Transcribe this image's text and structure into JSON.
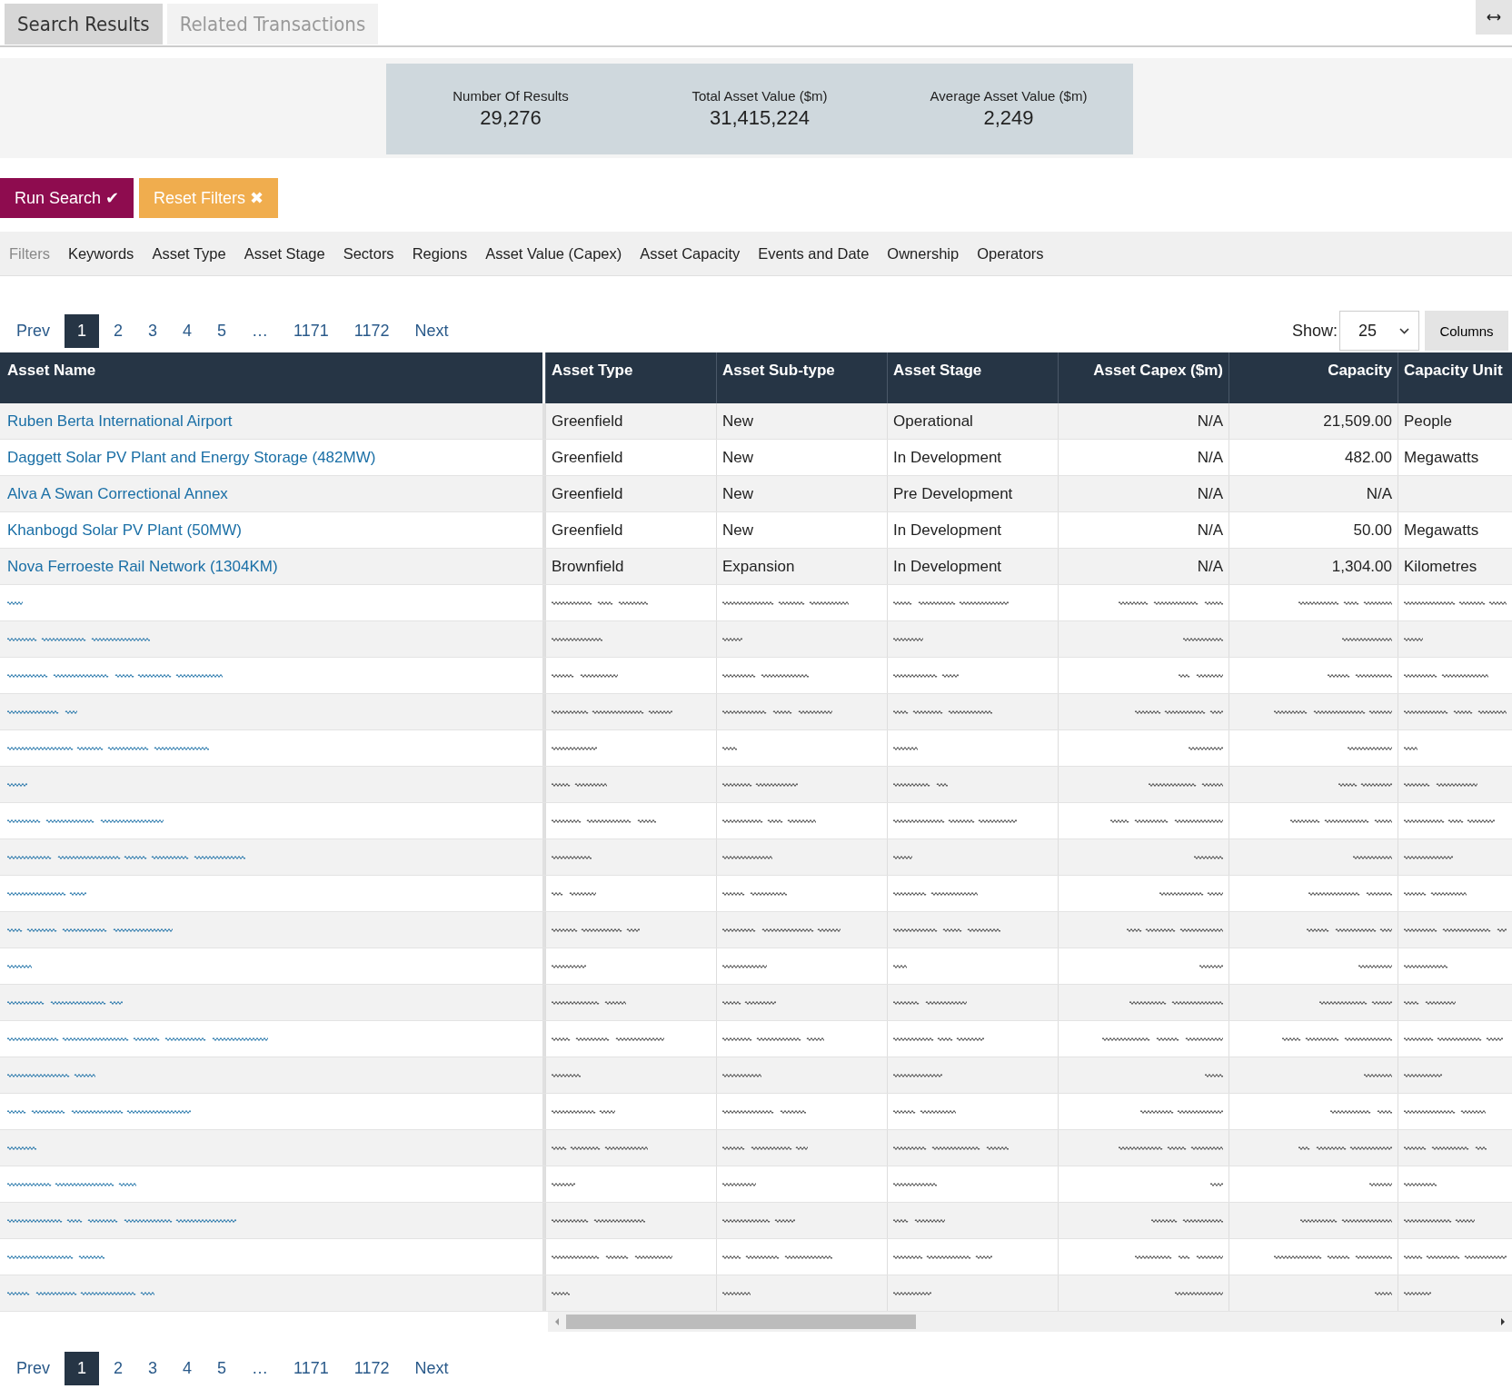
{
  "tabs": [
    {
      "label": "Search Results",
      "selected": true
    },
    {
      "label": "Related Transactions",
      "selected": false
    }
  ],
  "summary": [
    {
      "label": "Number Of Results",
      "value": "29,276"
    },
    {
      "label": "Total Asset Value ($m)",
      "value": "31,415,224"
    },
    {
      "label": "Average Asset Value ($m)",
      "value": "2,249"
    }
  ],
  "buttons": [
    {
      "kind": "run",
      "label": "Run Search",
      "icon": "✔"
    },
    {
      "kind": "reset",
      "label": "Reset Filters",
      "icon": "✖"
    }
  ],
  "filters": {
    "label": "Filters",
    "items": [
      "Keywords",
      "Asset Type",
      "Asset Stage",
      "Sectors",
      "Regions",
      "Asset Value (Capex)",
      "Asset Capacity",
      "Events and Date",
      "Ownership",
      "Operators"
    ]
  },
  "pagination_top": {
    "prev": "Prev",
    "next": "Next",
    "pages": [
      {
        "label": "1",
        "selected": true
      },
      {
        "label": "2",
        "selected": false
      },
      {
        "label": "3",
        "selected": false
      },
      {
        "label": "4",
        "selected": false
      },
      {
        "label": "5",
        "selected": false
      },
      {
        "label": "…",
        "selected": false
      },
      {
        "label": "1171",
        "selected": false
      },
      {
        "label": "1172",
        "selected": false
      }
    ]
  },
  "show": {
    "label": "Show:",
    "value": "25"
  },
  "columns_button": "Columns",
  "table": {
    "columns": [
      {
        "label": "Asset Name",
        "kind": "text"
      },
      {
        "label": "Asset Type",
        "kind": "text"
      },
      {
        "label": "Asset Sub-type",
        "kind": "text"
      },
      {
        "label": "Asset Stage",
        "kind": "text"
      },
      {
        "label": "Asset Capex ($m)",
        "kind": "number"
      },
      {
        "label": "Capacity",
        "kind": "number"
      },
      {
        "label": "Capacity Unit",
        "kind": "text"
      }
    ],
    "rows": [
      {
        "kind": "data",
        "cells": [
          "Ruben Berta International Airport",
          "Greenfield",
          "New",
          "Operational",
          "N/A",
          "21,509.00",
          "People"
        ]
      },
      {
        "kind": "data",
        "cells": [
          "Daggett Solar PV Plant and Energy Storage (482MW)",
          "Greenfield",
          "New",
          "In Development",
          "N/A",
          "482.00",
          "Megawatts"
        ]
      },
      {
        "kind": "data",
        "cells": [
          "Alva A Swan Correctional Annex",
          "Greenfield",
          "New",
          "Pre Development",
          "N/A",
          "N/A",
          ""
        ]
      },
      {
        "kind": "data",
        "cells": [
          "Khanbogd Solar PV Plant (50MW)",
          "Greenfield",
          "New",
          "In Development",
          "N/A",
          "50.00",
          "Megawatts"
        ]
      },
      {
        "kind": "data",
        "cells": [
          "Nova Ferroeste Rail Network (1304KM)",
          "Brownfield",
          "Expansion",
          "In Development",
          "N/A",
          "1,304.00",
          "Kilometres"
        ]
      },
      {
        "kind": "redacted"
      },
      {
        "kind": "redacted"
      },
      {
        "kind": "redacted"
      },
      {
        "kind": "redacted"
      },
      {
        "kind": "redacted"
      },
      {
        "kind": "redacted"
      },
      {
        "kind": "redacted"
      },
      {
        "kind": "redacted"
      },
      {
        "kind": "redacted"
      },
      {
        "kind": "redacted"
      },
      {
        "kind": "redacted"
      },
      {
        "kind": "redacted"
      },
      {
        "kind": "redacted"
      },
      {
        "kind": "redacted"
      },
      {
        "kind": "redacted"
      },
      {
        "kind": "redacted"
      },
      {
        "kind": "redacted"
      },
      {
        "kind": "redacted"
      },
      {
        "kind": "redacted"
      },
      {
        "kind": "redacted"
      }
    ]
  },
  "pagination_bottom": {
    "prev": "Prev",
    "next": "Next",
    "pages": [
      {
        "label": "1",
        "selected": true
      },
      {
        "label": "2",
        "selected": false
      },
      {
        "label": "3",
        "selected": false
      },
      {
        "label": "4",
        "selected": false
      },
      {
        "label": "5",
        "selected": false
      },
      {
        "label": "…",
        "selected": false
      },
      {
        "label": "1171",
        "selected": false
      },
      {
        "label": "1172",
        "selected": false
      }
    ]
  }
}
